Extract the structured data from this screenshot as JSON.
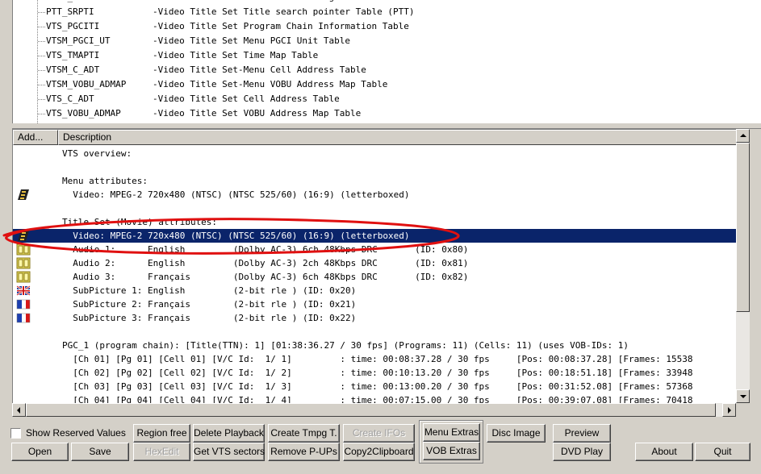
{
  "tree": {
    "items": [
      {
        "name": "VTSI_MAT",
        "desc": "-Video Title Set Information Management Table"
      },
      {
        "name": "PTT_SRPTI",
        "desc": "-Video Title Set Title search pointer Table (PTT)"
      },
      {
        "name": "VTS_PGCITI",
        "desc": "-Video Title Set Program Chain Information Table"
      },
      {
        "name": "VTSM_PGCI_UT",
        "desc": "-Video Title Set Menu PGCI Unit Table"
      },
      {
        "name": "VTS_TMAPTI",
        "desc": "-Video Title Set Time Map Table"
      },
      {
        "name": "VTSM_C_ADT",
        "desc": "-Video Title Set-Menu Cell Address Table"
      },
      {
        "name": "VTSM_VOBU_ADMAP",
        "desc": "-Video Title Set-Menu VOBU Address Map Table"
      },
      {
        "name": "VTS_C_ADT",
        "desc": "-Video Title Set Cell Address Table"
      },
      {
        "name": "VTS_VOBU_ADMAP",
        "desc": "-Video Title Set VOBU Address Map Table"
      }
    ]
  },
  "list": {
    "columns": [
      "Add...",
      "Description"
    ],
    "rows": [
      {
        "icon": "",
        "text": "VTS overview:"
      },
      {
        "icon": "",
        "text": ""
      },
      {
        "icon": "",
        "text": "Menu attributes:"
      },
      {
        "icon": "film-icon",
        "text": "  Video: MPEG-2 720x480 (NTSC) (NTSC 525/60) (16:9) (letterboxed)"
      },
      {
        "icon": "",
        "text": ""
      },
      {
        "icon": "",
        "text": "Title Set (Movie) attributes:"
      },
      {
        "icon": "film-icon",
        "text": "  Video: MPEG-2 720x480 (NTSC) (NTSC 525/60) (16:9) (letterboxed)",
        "selected": true
      },
      {
        "icon": "audio-icon",
        "text": "  Audio 1:      English         (Dolby AC-3) 6ch 48Kbps DRC       (ID: 0x80)"
      },
      {
        "icon": "audio-icon",
        "text": "  Audio 2:      English         (Dolby AC-3) 2ch 48Kbps DRC       (ID: 0x81)"
      },
      {
        "icon": "audio-icon",
        "text": "  Audio 3:      Français        (Dolby AC-3) 6ch 48Kbps DRC       (ID: 0x82)"
      },
      {
        "icon": "uk-flag-icon",
        "text": "  SubPicture 1: English         (2-bit rle ) (ID: 0x20)"
      },
      {
        "icon": "fr-flag-icon",
        "text": "  SubPicture 2: Français        (2-bit rle ) (ID: 0x21)"
      },
      {
        "icon": "fr-flag-icon",
        "text": "  SubPicture 3: Français        (2-bit rle ) (ID: 0x22)"
      },
      {
        "icon": "",
        "text": ""
      },
      {
        "icon": "",
        "text": "PGC_1 (program chain): [Title(TTN): 1] [01:38:36.27 / 30 fps] (Programs: 11) (Cells: 11) (uses VOB-IDs: 1)"
      },
      {
        "icon": "",
        "text": "  [Ch 01] [Pg 01] [Cell 01] [V/C Id:  1/ 1]         : time: 00:08:37.28 / 30 fps     [Pos: 00:08:37.28] [Frames: 15538"
      },
      {
        "icon": "",
        "text": "  [Ch 02] [Pg 02] [Cell 02] [V/C Id:  1/ 2]         : time: 00:10:13.20 / 30 fps     [Pos: 00:18:51.18] [Frames: 33948"
      },
      {
        "icon": "",
        "text": "  [Ch 03] [Pg 03] [Cell 03] [V/C Id:  1/ 3]         : time: 00:13:00.20 / 30 fps     [Pos: 00:31:52.08] [Frames: 57368"
      },
      {
        "icon": "",
        "text": "  [Ch 04] [Pg 04] [Cell 04] [V/C Id:  1/ 4]         : time: 00:07:15.00 / 30 fps     [Pos: 00:39:07.08] [Frames: 70418"
      }
    ]
  },
  "controls": {
    "show_reserved": "Show Reserved Values",
    "open": "Open",
    "save": "Save",
    "region_free": "Region free",
    "hexedit": "HexEdit",
    "delete_playback": "Delete Playback",
    "get_vts_sectors": "Get VTS sectors",
    "create_tmpg": "Create Tmpg T.",
    "remove_pups": "Remove P-UPs",
    "create_ifos": "Create IFOs",
    "copy2clipboard": "Copy2Clipboard",
    "menu_extras": "Menu Extras",
    "vob_extras": "VOB Extras",
    "disc_image": "Disc Image",
    "preview": "Preview",
    "dvd_play": "DVD Play",
    "about": "About",
    "quit": "Quit"
  },
  "colors": {
    "selection": "#0a246a",
    "annotation": "#e01010",
    "face": "#d4d0c8"
  }
}
